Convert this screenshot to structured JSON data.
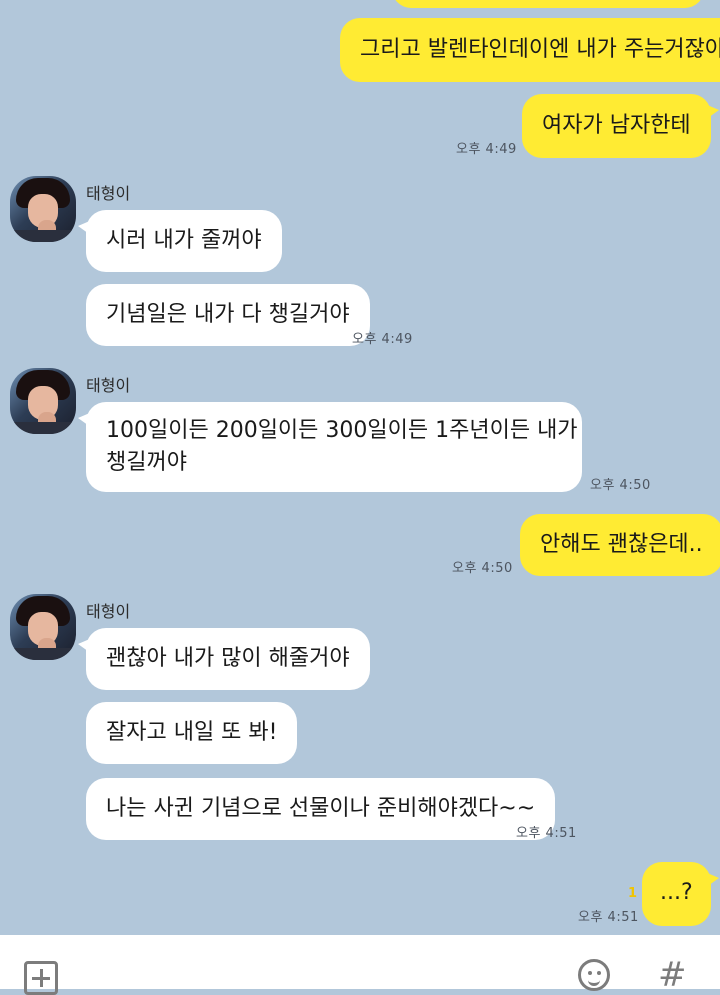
{
  "contact_name": "태형이",
  "messages": [
    {
      "id": "m1",
      "sender": "me",
      "text": "그리고 발렌타인데이엔 내가 주는거잖아"
    },
    {
      "id": "m2",
      "sender": "me",
      "text": "여자가 남자한테",
      "time": "오후 4:49"
    },
    {
      "id": "m3",
      "sender": "other",
      "text": "시러 내가 줄꺼야"
    },
    {
      "id": "m4",
      "sender": "other",
      "text": "기념일은 내가 다 챙길거야",
      "time": "오후 4:49"
    },
    {
      "id": "m5",
      "sender": "other",
      "text_line1": "100일이든 200일이든 300일이든 1주년이든 내가",
      "text_line2": "챙길꺼야",
      "time": "오후 4:50"
    },
    {
      "id": "m6",
      "sender": "me",
      "text": "안해도 괜찮은데..",
      "time": "오후 4:50"
    },
    {
      "id": "m7",
      "sender": "other",
      "text": "괜찮아 내가 많이 해줄거야"
    },
    {
      "id": "m8",
      "sender": "other",
      "text": "잘자고 내일 또 봐!"
    },
    {
      "id": "m9",
      "sender": "other",
      "text": "나는 사귄 기념으로 선물이나 준비해야겠다~~",
      "time": "오후 4:51"
    },
    {
      "id": "m10",
      "sender": "me",
      "text": "...?",
      "time": "오후 4:51",
      "unread": "1"
    }
  ],
  "input_bar": {
    "plus_icon": "plus-square-icon",
    "emoji_icon": "smiley-icon",
    "hash_label": "#"
  },
  "colors": {
    "background": "#b2c7da",
    "my_bubble": "#ffeb33",
    "their_bubble": "#ffffff"
  }
}
